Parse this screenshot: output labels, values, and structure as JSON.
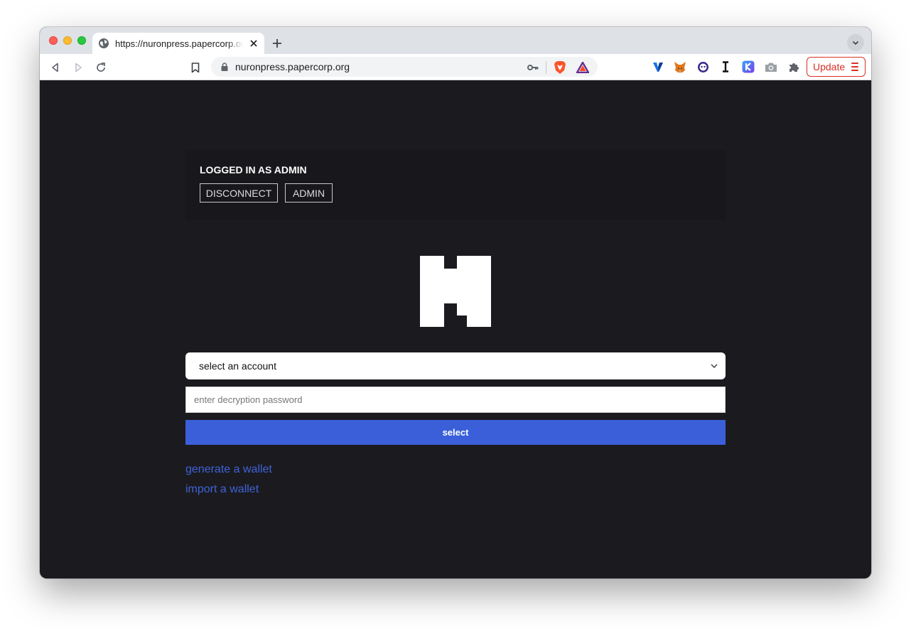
{
  "browser": {
    "tab": {
      "title": "https://nuronpress.papercorp.org",
      "favicon": "globe-icon"
    },
    "new_tab_icon": "plus-icon",
    "toolbar": {
      "back_icon": "back-arrow-icon",
      "forward_icon": "forward-arrow-icon",
      "reload_icon": "reload-icon",
      "bookmark_icon": "bookmark-icon"
    },
    "omnibox": {
      "url": "nuronpress.papercorp.org",
      "lock_icon": "lock-icon",
      "key_icon": "key-icon"
    },
    "extensions": [
      "brave-shield-icon",
      "brave-rewards-icon",
      "v-extension-icon",
      "metamask-fox-icon",
      "smiley-extension-icon",
      "instapaper-icon",
      "keplr-icon",
      "camera-icon",
      "puzzle-icon"
    ],
    "update_label": "Update",
    "colors": {
      "tabstrip": "#dee1e6",
      "update_red": "#d93025"
    }
  },
  "page": {
    "status": {
      "text": "LOGGED IN AS ADMIN",
      "disconnect_label": "DISCONNECT",
      "admin_label": "ADMIN"
    },
    "logo": "nuron-logo",
    "account_select": {
      "selected": "select an account"
    },
    "password": {
      "placeholder": "enter decryption password",
      "value": ""
    },
    "select_label": "select",
    "links": {
      "generate": "generate a wallet",
      "import": "import a wallet"
    },
    "colors": {
      "background": "#1b1a1f",
      "primary": "#3a5fd9",
      "link": "#3e63d8"
    }
  }
}
